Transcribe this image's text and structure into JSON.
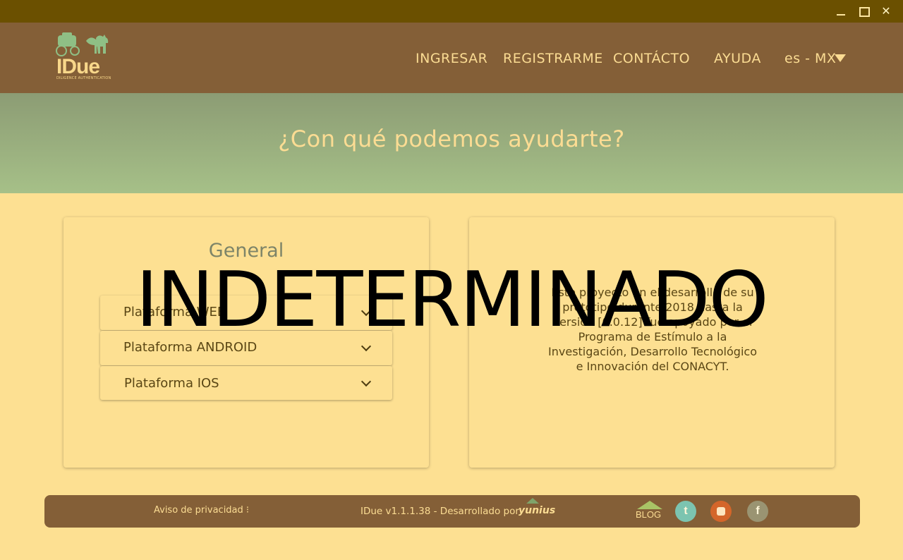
{
  "window": {
    "close_glyph": "✕"
  },
  "nav": {
    "logo_text": "IDue",
    "logo_subtitle": "DILIGENCE AUTHENTICATION",
    "items": [
      "INGRESAR",
      "REGISTRARME",
      "CONTÁCTO",
      "AYUDA"
    ],
    "language": "es - MX"
  },
  "hero": {
    "title": "¿Con qué podemos ayudarte?"
  },
  "general": {
    "title": "General",
    "accordions": [
      "Plataforma WEB",
      "Plataforma ANDROID",
      "Plataforma IOS"
    ]
  },
  "info": {
    "text": "Este proyecto en el desarrollo de su prototipo durante 2018 hasta la versión [0.0.12] fue apoyado por el Programa de Estímulo a la Investigación, Desarrollo Tecnológico e Innovación del CONACYT."
  },
  "overlay": {
    "text": "INDETERMINADO"
  },
  "footer": {
    "privacy": "Aviso de privacidad ⁝",
    "version": "IDue v1.1.1.38 - Desarrollado por",
    "brand": "yunius",
    "blog": "BLOG",
    "twitter_glyph": "t",
    "facebook_glyph": "f"
  },
  "icons": {
    "minimize": "minimize-icon",
    "maximize": "maximize-icon",
    "close": "close-icon",
    "caret": "caret-down-icon",
    "chevron": "chevron-down-icon",
    "twitter": "twitter-icon",
    "youtube": "youtube-icon",
    "facebook": "facebook-icon",
    "blog": "blog-icon"
  },
  "colors": {
    "titlebar": "#6b5000",
    "navbar": "#845f37",
    "hero_top": "#8c9c74",
    "hero_bottom": "#a6c088",
    "page": "#fde092",
    "accent_text": "#fbdc93"
  }
}
